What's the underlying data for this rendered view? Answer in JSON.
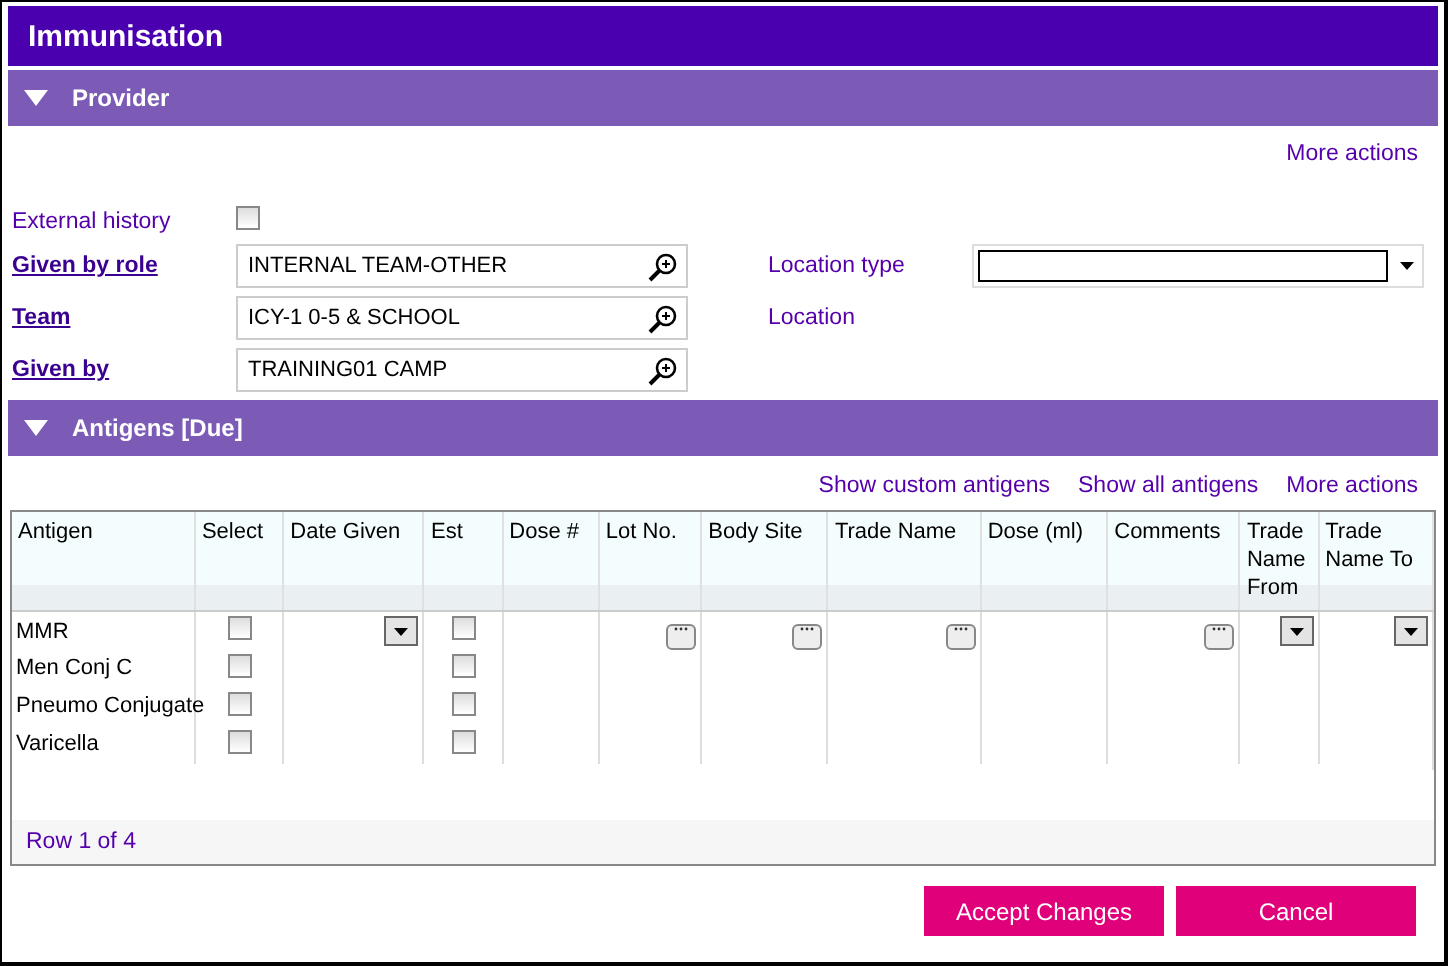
{
  "window": {
    "title": "Immunisation"
  },
  "provider": {
    "title": "Provider",
    "expanded": true,
    "more_actions": "More actions",
    "external_history": {
      "label": "External history",
      "checked": false
    },
    "fields": [
      {
        "label": "Given by role",
        "value": "INTERNAL TEAM-OTHER"
      },
      {
        "label": "Team",
        "value": "ICY-1 0-5 & SCHOOL"
      },
      {
        "label": "Given by",
        "value": "TRAINING01 CAMP"
      }
    ],
    "location_type": {
      "label": "Location type"
    },
    "location": {
      "label": "Location"
    }
  },
  "antigens": {
    "title": "Antigens [Due]",
    "expanded": true,
    "links": [
      "Show custom antigens",
      "Show all antigens",
      "More actions"
    ],
    "table": {
      "columns": [
        "Antigen",
        "Select",
        "Date Given",
        "Est",
        "Dose #",
        "Lot No.",
        "Body Site",
        "Trade Name",
        "Dose (ml)",
        "Comments",
        "Trade Name From",
        "Trade Name To"
      ],
      "rows": [
        {
          "antigen": "MMR",
          "selected": false,
          "est": false,
          "active": true
        },
        {
          "antigen": "Men Conj C",
          "selected": false,
          "est": false,
          "active": false
        },
        {
          "antigen": "Pneumo Conjugate",
          "selected": false,
          "est": false,
          "active": false
        },
        {
          "antigen": "Varicella",
          "selected": false,
          "est": false,
          "active": false
        }
      ],
      "footer": "Row 1 of 4"
    }
  },
  "buttons": [
    "Accept Changes",
    "Cancel"
  ]
}
